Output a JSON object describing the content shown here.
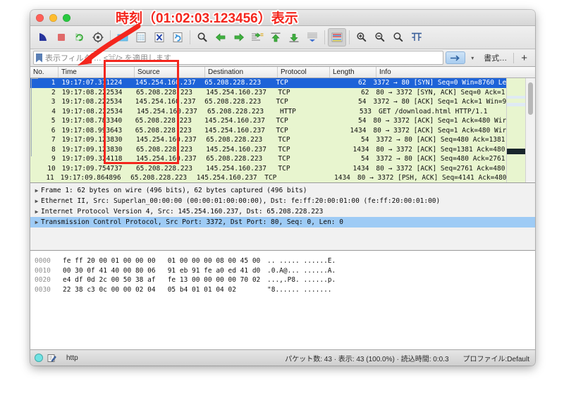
{
  "window": {
    "traffic_lights": [
      "close",
      "minimize",
      "maximize"
    ]
  },
  "toolbar": {
    "icons": [
      {
        "name": "start-capture-icon",
        "label": "Start"
      },
      {
        "name": "stop-capture-icon",
        "label": "Stop"
      },
      {
        "name": "restart-capture-icon",
        "label": "Restart"
      },
      {
        "name": "capture-options-icon",
        "label": "Capture Options"
      },
      {
        "name": "open-file-icon",
        "label": "Open"
      },
      {
        "name": "save-file-icon",
        "label": "Save"
      },
      {
        "name": "close-file-icon",
        "label": "Close"
      },
      {
        "name": "reload-file-icon",
        "label": "Reload"
      },
      {
        "name": "find-packet-icon",
        "label": "Find Packet"
      },
      {
        "name": "go-back-icon",
        "label": "Go Back"
      },
      {
        "name": "go-forward-icon",
        "label": "Go Forward"
      },
      {
        "name": "go-to-packet-icon",
        "label": "Go to Packet"
      },
      {
        "name": "go-to-first-icon",
        "label": "First Packet"
      },
      {
        "name": "go-to-last-icon",
        "label": "Last Packet"
      },
      {
        "name": "auto-scroll-icon",
        "label": "Auto Scroll"
      },
      {
        "name": "colorize-icon",
        "label": "Colorize"
      },
      {
        "name": "zoom-in-icon",
        "label": "Zoom In"
      },
      {
        "name": "zoom-out-icon",
        "label": "Zoom Out"
      },
      {
        "name": "zoom-reset-icon",
        "label": "Normal Size"
      },
      {
        "name": "resize-columns-icon",
        "label": "Resize Columns"
      }
    ]
  },
  "filter_bar": {
    "placeholder": "表示フィルタ … <⌘/> を適用します",
    "value": "",
    "apply_label": "→",
    "caret_label": "▾",
    "format_label": "書式…",
    "plus_label": "+"
  },
  "packet_list": {
    "columns": [
      "No.",
      "Time",
      "Source",
      "Destination",
      "Protocol",
      "Length",
      "Info"
    ],
    "rows": [
      {
        "no": "1",
        "time": "19:17:07.311224",
        "src": "145.254.160.237",
        "dst": "65.208.228.223",
        "proto": "TCP",
        "len": "62",
        "info": "3372 → 80 [SYN] Seq=0 Win=8760 Le",
        "selected": true
      },
      {
        "no": "2",
        "time": "19:17:08.222534",
        "src": "65.208.228.223",
        "dst": "145.254.160.237",
        "proto": "TCP",
        "len": "62",
        "info": "80 → 3372 [SYN, ACK] Seq=0 Ack=1",
        "selected": false
      },
      {
        "no": "3",
        "time": "19:17:08.222534",
        "src": "145.254.160.237",
        "dst": "65.208.228.223",
        "proto": "TCP",
        "len": "54",
        "info": "3372 → 80 [ACK] Seq=1 Ack=1 Win=9",
        "selected": false
      },
      {
        "no": "4",
        "time": "19:17:08.222534",
        "src": "145.254.160.237",
        "dst": "65.208.228.223",
        "proto": "HTTP",
        "len": "533",
        "info": "GET /download.html HTTP/1.1",
        "selected": false
      },
      {
        "no": "5",
        "time": "19:17:08.783340",
        "src": "65.208.228.223",
        "dst": "145.254.160.237",
        "proto": "TCP",
        "len": "54",
        "info": "80 → 3372 [ACK] Seq=1 Ack=480 Wir",
        "selected": false
      },
      {
        "no": "6",
        "time": "19:17:08.993643",
        "src": "65.208.228.223",
        "dst": "145.254.160.237",
        "proto": "TCP",
        "len": "1434",
        "info": "80 → 3372 [ACK] Seq=1 Ack=480 Wir",
        "selected": false
      },
      {
        "no": "7",
        "time": "19:17:09.123830",
        "src": "145.254.160.237",
        "dst": "65.208.228.223",
        "proto": "TCP",
        "len": "54",
        "info": "3372 → 80 [ACK] Seq=480 Ack=1381",
        "selected": false
      },
      {
        "no": "8",
        "time": "19:17:09.123830",
        "src": "65.208.228.223",
        "dst": "145.254.160.237",
        "proto": "TCP",
        "len": "1434",
        "info": "80 → 3372 [ACK] Seq=1381 Ack=480",
        "selected": false
      },
      {
        "no": "9",
        "time": "19:17:09.324118",
        "src": "145.254.160.237",
        "dst": "65.208.228.223",
        "proto": "TCP",
        "len": "54",
        "info": "3372 → 80 [ACK] Seq=480 Ack=2761",
        "selected": false
      },
      {
        "no": "10",
        "time": "19:17:09.754737",
        "src": "65.208.228.223",
        "dst": "145.254.160.237",
        "proto": "TCP",
        "len": "1434",
        "info": "80 → 3372 [ACK] Seq=2761 Ack=480",
        "selected": false
      },
      {
        "no": "11",
        "time": "19:17:09.864896",
        "src": "65.208.228.223",
        "dst": "145.254.160.237",
        "proto": "TCP",
        "len": "1434",
        "info": "80 → 3372 [PSH, ACK] Seq=4141 Ack=480 W",
        "selected": false
      }
    ]
  },
  "detail_pane": {
    "rows": [
      {
        "text": "Frame 1: 62 bytes on wire (496 bits), 62 bytes captured (496 bits)",
        "selected": false
      },
      {
        "text": "Ethernet II, Src: Superlan_00:00:00 (00:00:01:00:00:00), Dst: fe:ff:20:00:01:00 (fe:ff:20:00:01:00)",
        "selected": false
      },
      {
        "text": "Internet Protocol Version 4, Src: 145.254.160.237, Dst: 65.208.228.223",
        "selected": false
      },
      {
        "text": "Transmission Control Protocol, Src Port: 3372, Dst Port: 80, Seq: 0, Len: 0",
        "selected": true
      }
    ]
  },
  "hex_pane": {
    "rows": [
      {
        "offset": "0000",
        "hex": "fe ff 20 00 01 00 00 00   01 00 00 00 08 00 45 00",
        "ascii": ".. ..... ......E."
      },
      {
        "offset": "0010",
        "hex": "00 30 0f 41 40 00 80 06   91 eb 91 fe a0 ed 41 d0",
        "ascii": ".0.A@... ......A."
      },
      {
        "offset": "0020",
        "hex": "e4 df 0d 2c 00 50 38 af   fe 13 00 00 00 00 70 02",
        "ascii": "...,.P8. ......p."
      },
      {
        "offset": "0030",
        "hex": "22 38 c3 0c 00 00 02 04   05 b4 01 01 04 02",
        "ascii": "\"8...... ......."
      }
    ]
  },
  "status_bar": {
    "file_label": "http",
    "stats": "パケット数: 43 · 表示: 43 (100.0%) · 読込時間: 0:0.3",
    "profile": "プロファイル:Default"
  },
  "annotation": {
    "text": "時刻（01:02:03.123456）表示",
    "color": "#f4261d"
  }
}
